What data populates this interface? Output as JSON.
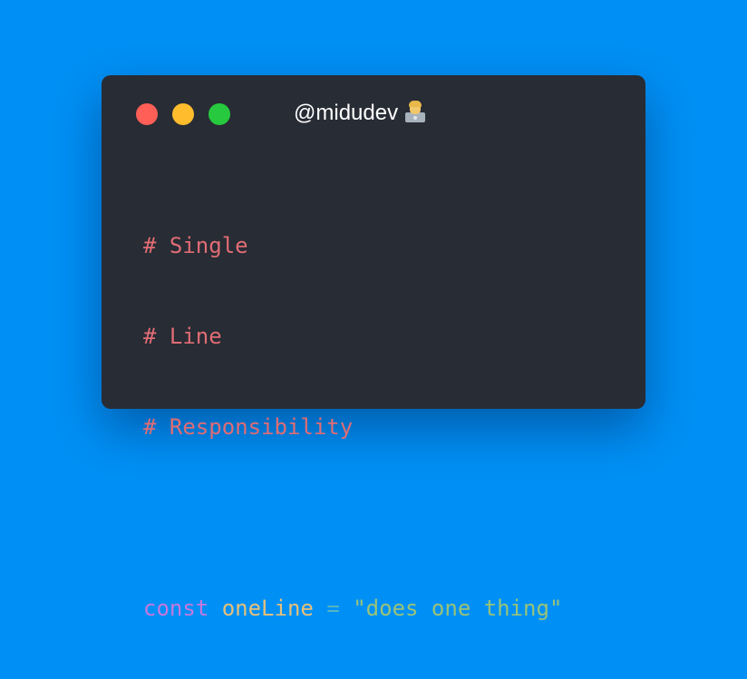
{
  "window": {
    "title": "@midudev",
    "title_emoji": "technologist-emoji",
    "controls": [
      "close",
      "minimize",
      "maximize"
    ]
  },
  "code": {
    "comments": [
      "# Single",
      "# Line",
      "# Responsibility"
    ],
    "statement": {
      "keyword": "const",
      "identifier": "oneLine",
      "operator": "=",
      "string": "\"does one thing\""
    }
  },
  "colors": {
    "background": "#0090f5",
    "window": "#282c34",
    "close": "#ff5f56",
    "minimize": "#ffbd2e",
    "maximize": "#27c93f",
    "comment": "#e06c75",
    "keyword": "#c678dd",
    "identifier": "#e5c07b",
    "operator": "#56b6c2",
    "string": "#98c379"
  }
}
